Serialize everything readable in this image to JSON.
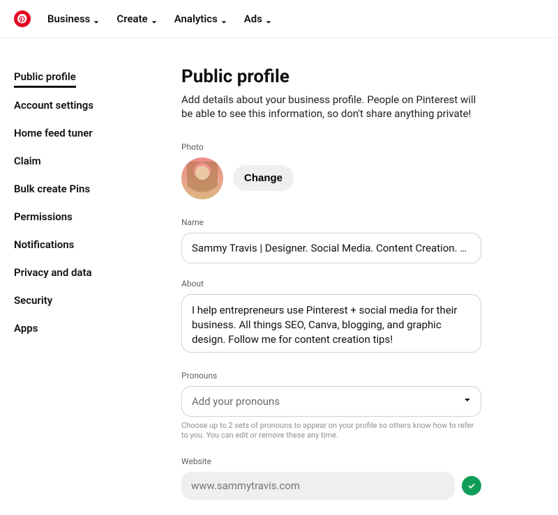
{
  "nav": {
    "items": [
      {
        "label": "Business"
      },
      {
        "label": "Create"
      },
      {
        "label": "Analytics"
      },
      {
        "label": "Ads"
      }
    ]
  },
  "sidebar": {
    "items": [
      {
        "label": "Public profile",
        "active": true
      },
      {
        "label": "Account settings"
      },
      {
        "label": "Home feed tuner"
      },
      {
        "label": "Claim"
      },
      {
        "label": "Bulk create Pins"
      },
      {
        "label": "Permissions"
      },
      {
        "label": "Notifications"
      },
      {
        "label": "Privacy and data"
      },
      {
        "label": "Security"
      },
      {
        "label": "Apps"
      }
    ]
  },
  "page": {
    "title": "Public profile",
    "description": "Add details about your business profile. People on Pinterest will be able to see this information, so don't share anything private!"
  },
  "photo": {
    "label": "Photo",
    "change_label": "Change"
  },
  "name": {
    "label": "Name",
    "value": "Sammy Travis | Designer. Social Media. Content Creation. Bl..."
  },
  "about": {
    "label": "About",
    "value": "I help entrepreneurs use Pinterest + social media for their business. All things SEO, Canva, blogging, and graphic design. Follow me for content creation tips!"
  },
  "pronouns": {
    "label": "Pronouns",
    "placeholder": "Add your pronouns",
    "help": "Choose up to 2 sets of pronouns to appear on your profile so others know how to refer to you. You can edit or remove these any time."
  },
  "website": {
    "label": "Website",
    "value": "www.sammytravis.com"
  }
}
